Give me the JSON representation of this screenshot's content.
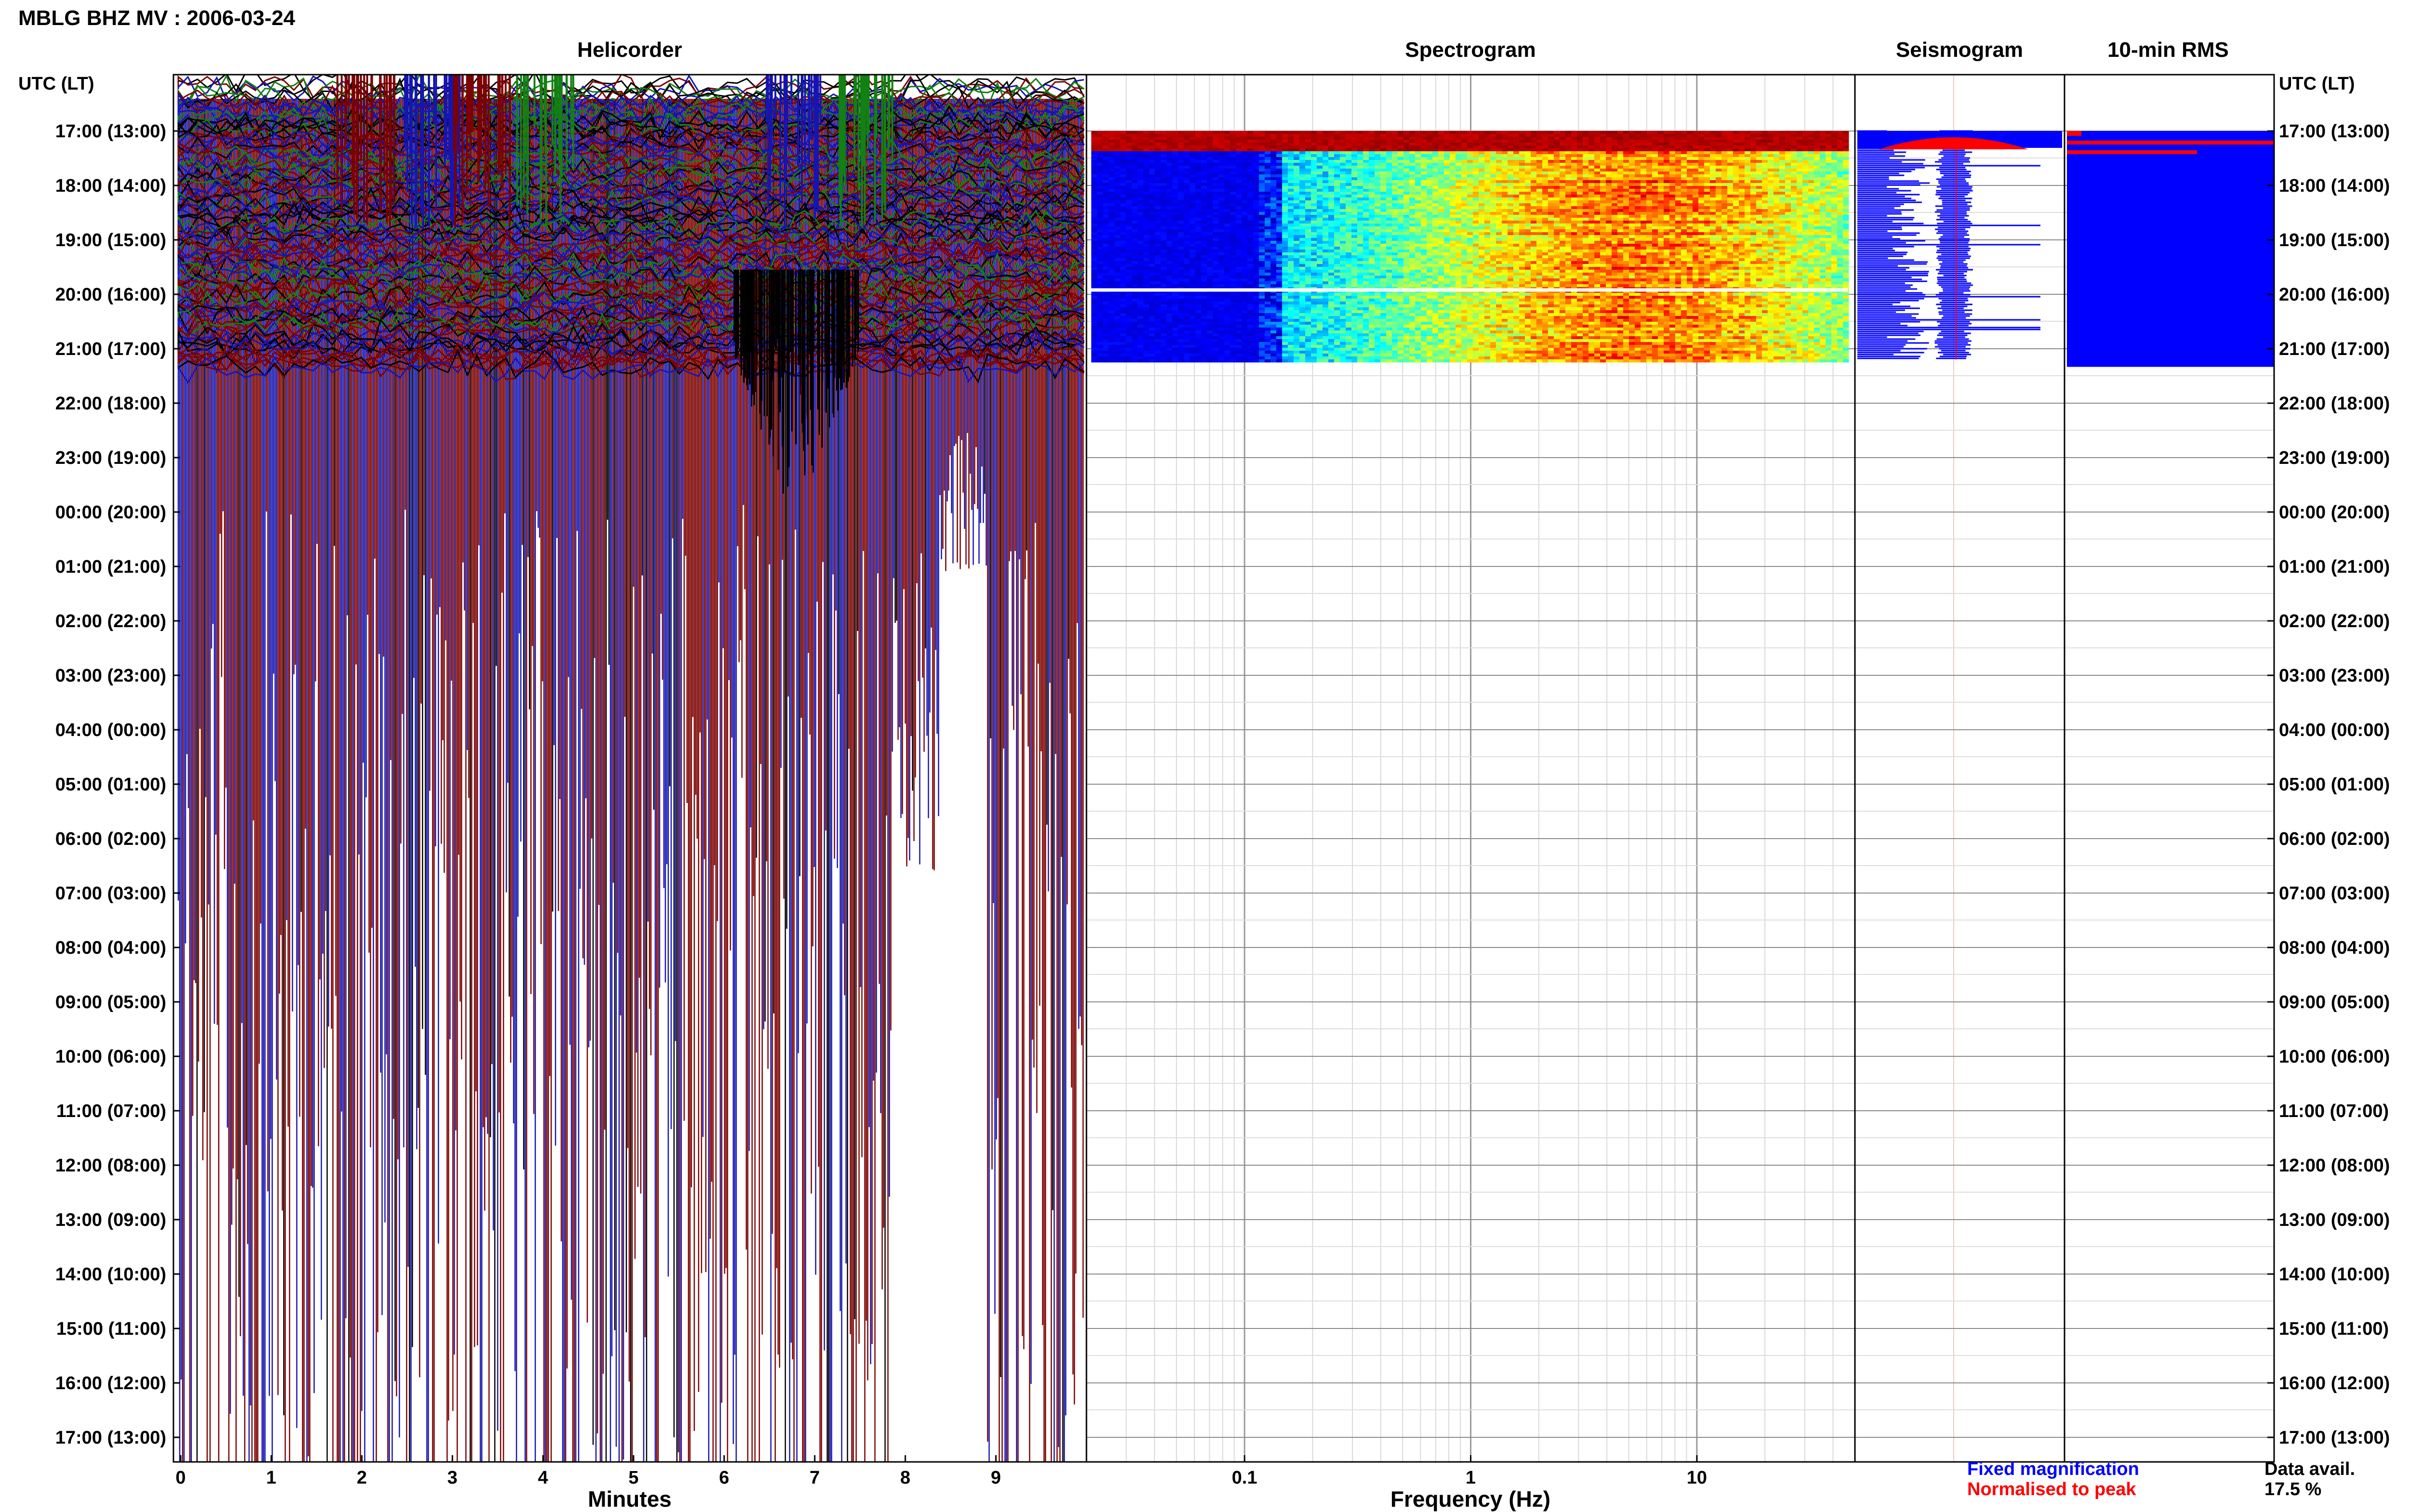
{
  "header": {
    "title": "MBLG BHZ MV : 2006-03-24"
  },
  "axes": {
    "left_label": "UTC (LT)",
    "right_label": "UTC (LT)"
  },
  "panels": {
    "helicorder": {
      "title": "Helicorder",
      "xlabel": "Minutes",
      "xticks": [
        "0",
        "1",
        "2",
        "3",
        "4",
        "5",
        "6",
        "7",
        "8",
        "9"
      ]
    },
    "spectrogram": {
      "title": "Spectrogram",
      "xlabel": "Frequency (Hz)",
      "xticks": [
        "0.1",
        "1",
        "10"
      ]
    },
    "seismogram": {
      "title": "Seismogram"
    },
    "rms": {
      "title": "10-min RMS"
    }
  },
  "legend": {
    "fixed": "Fixed magnification",
    "normalised": "Normalised to peak"
  },
  "availability": {
    "label": "Data avail.",
    "value": "17.5 %"
  },
  "colors": {
    "blue": "#1515b4",
    "darkred": "#7d0000",
    "green": "#128012",
    "black": "#000000",
    "red": "#ff0000",
    "legend_blue": "#0000ff",
    "legend_red": "#ff0000"
  },
  "chart_data": {
    "type": "heatmap",
    "title": "MBLG BHZ MV : 2006-03-24",
    "time_rows": [
      "17:00 (13:00)",
      "18:00 (14:00)",
      "19:00 (15:00)",
      "20:00 (16:00)",
      "21:00 (17:00)",
      "22:00 (18:00)",
      "23:00 (19:00)",
      "00:00 (20:00)",
      "01:00 (21:00)",
      "02:00 (22:00)",
      "03:00 (23:00)",
      "04:00 (00:00)",
      "05:00 (01:00)",
      "06:00 (02:00)",
      "07:00 (03:00)",
      "08:00 (04:00)",
      "09:00 (05:00)",
      "10:00 (06:00)",
      "11:00 (07:00)",
      "12:00 (08:00)",
      "13:00 (09:00)",
      "14:00 (10:00)",
      "15:00 (11:00)",
      "16:00 (12:00)",
      "17:00 (13:00)"
    ],
    "helicorder": {
      "xlabel": "Minutes",
      "xlim": [
        0,
        10
      ],
      "data_rows_hours": [
        17,
        21.2
      ]
    },
    "spectrogram": {
      "xlabel": "Frequency (Hz)",
      "xscale": "log",
      "xlim": [
        0.02,
        50
      ],
      "data_rows_hours": [
        17,
        21.2
      ]
    },
    "rms_10min": {
      "data_rows_hours": [
        17,
        21.2
      ]
    },
    "data_availability_percent": 17.5
  }
}
